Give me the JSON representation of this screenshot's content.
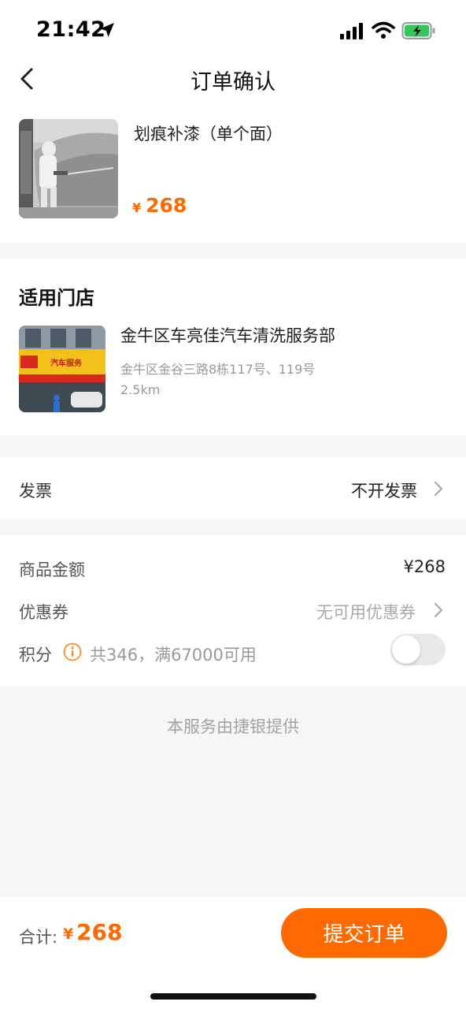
{
  "status": {
    "time": "21:42"
  },
  "nav": {
    "title": "订单确认"
  },
  "product": {
    "name": "划痕补漆（单个面）",
    "currency": "¥",
    "price": "268",
    "image": "car-painting-photo"
  },
  "store": {
    "section_title": "适用门店",
    "name": "金牛区车亮佳汽车清洗服务部",
    "address": "金牛区金谷三路8栋117号、119号",
    "distance": "2.5km",
    "image": "storefront-photo",
    "sign_text": "汽车服务"
  },
  "invoice": {
    "label": "发票",
    "value": "不开发票"
  },
  "amounts": {
    "goods_label": "商品金额",
    "goods_value": "¥268",
    "coupon_label": "优惠券",
    "coupon_value": "无可用优惠券",
    "points_label": "积分",
    "points_desc": "共346，满67000可用",
    "points_enabled": false
  },
  "provider": "本服务由捷银提供",
  "footer": {
    "total_label": "合计:",
    "currency": "¥",
    "total": "268",
    "submit": "提交订单"
  },
  "colors": {
    "accent": "#ff6a00",
    "background": "#f5f6f8"
  }
}
